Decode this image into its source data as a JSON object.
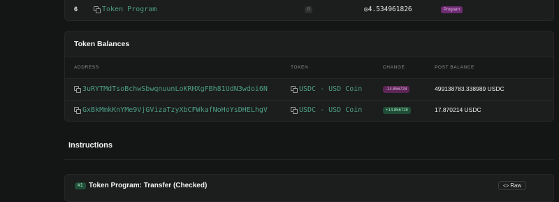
{
  "accounts_row": {
    "index": "6",
    "name": "Token Program",
    "count_badge": "0",
    "balance": "◎4.534961826",
    "type_badge": "Program"
  },
  "token_balances": {
    "title": "Token Balances",
    "columns": [
      "ADDRESS",
      "TOKEN",
      "CHANGE",
      "POST BALANCE"
    ],
    "rows": [
      {
        "address": "3uRYTMdTsoBchwSbwqnuunLoKRHXgFBh81UdN3wdoi6N",
        "token": "USDC - USD Coin",
        "change": "-14.856728",
        "post_balance": "499138783.338989 USDC"
      },
      {
        "address": "GxBkMmkKnYMe9VjGVizaTzyXbCFWkafNoHoYsDHELhgV",
        "token": "USDC - USD Coin",
        "change": "+14.856728",
        "post_balance": "17.870214 USDC"
      }
    ]
  },
  "instructions": {
    "title": "Instructions",
    "first": {
      "number": "#1",
      "name": "Token Program: Transfer (Checked)",
      "raw_label": "Raw"
    }
  },
  "colors": {
    "background": "#141515",
    "card": "#1c1d1d",
    "link": "#4d9e86",
    "negative_badge": "#5b2656",
    "positive_badge": "#1f4d37",
    "program_badge": "#6e2c72"
  }
}
